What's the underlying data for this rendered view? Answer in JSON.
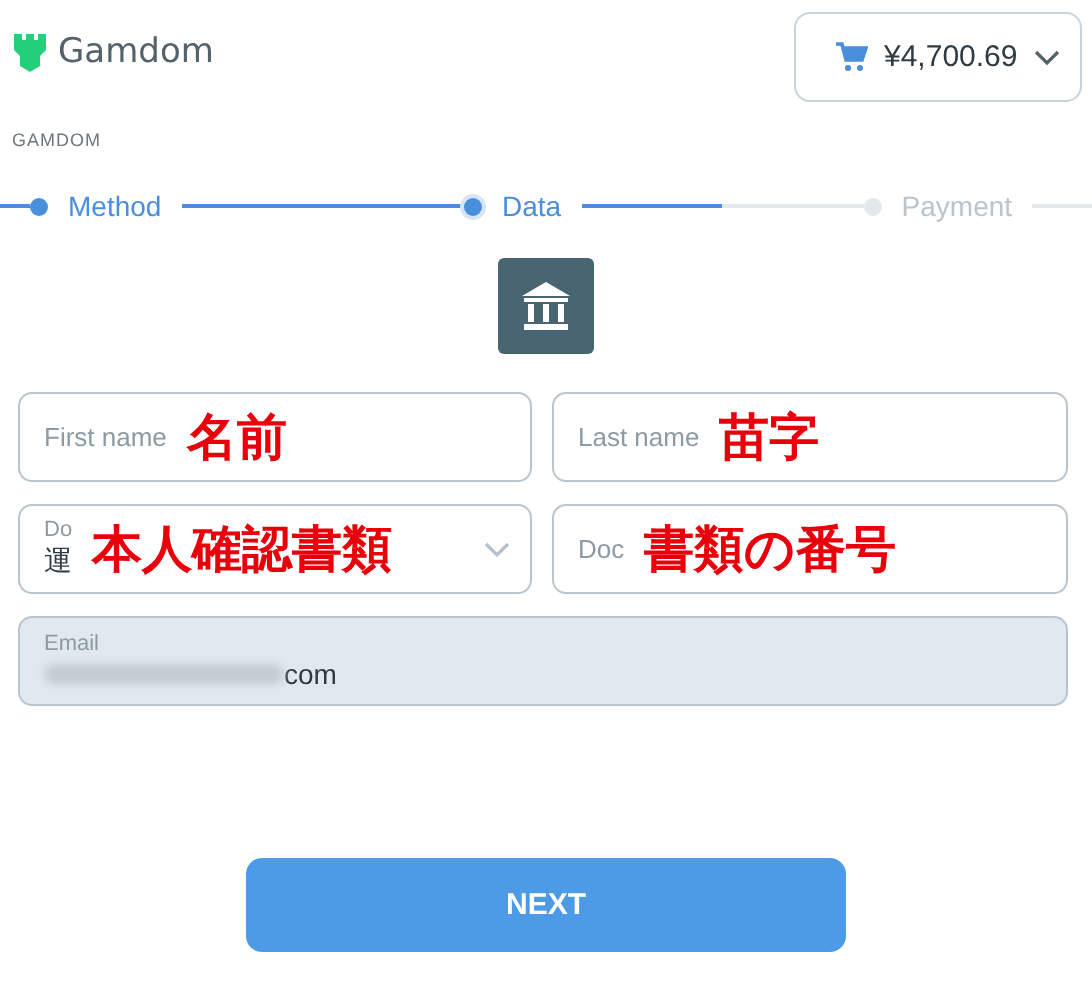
{
  "brand": {
    "name": "Gamdom"
  },
  "cart": {
    "amount": "¥4,700.69"
  },
  "merchant": "GAMDOM",
  "steps": [
    {
      "label": "Method",
      "completed": true,
      "selected": false
    },
    {
      "label": "Data",
      "completed": false,
      "selected": true
    },
    {
      "label": "Payment",
      "completed": false,
      "selected": false
    }
  ],
  "fields": [
    {
      "kind": "text",
      "placeholder": "First name",
      "note": "名前"
    },
    {
      "kind": "text",
      "placeholder": "Last name",
      "note": "苗字"
    },
    {
      "kind": "select",
      "label": "Do",
      "value": "運",
      "note": "本人確認書類"
    },
    {
      "kind": "text",
      "placeholder": "Doc",
      "note": "書類の番号"
    },
    {
      "kind": "filled",
      "label": "Email",
      "value": "com",
      "disabled": true
    }
  ],
  "buttons": [
    {
      "label": "NEXT"
    }
  ]
}
